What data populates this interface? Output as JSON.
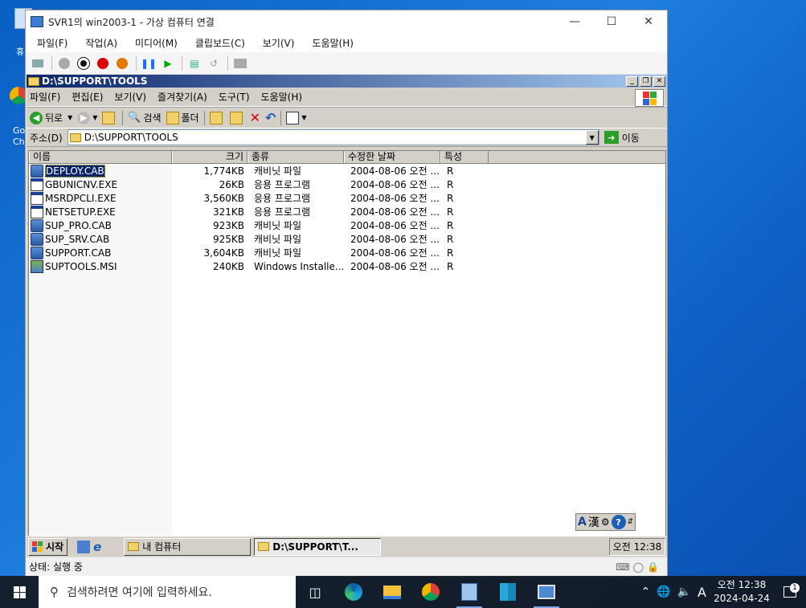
{
  "desktop": {
    "icon_labels": [
      "휴",
      "Go",
      "Ch"
    ]
  },
  "vm_window": {
    "title": "SVR1의 win2003-1 - 가상 컴퓨터 연결",
    "menu": [
      "파일(F)",
      "작업(A)",
      "미디어(M)",
      "클립보드(C)",
      "보기(V)",
      "도움말(H)"
    ],
    "status_label": "상태: 실행 중"
  },
  "explorer": {
    "title": "D:\\SUPPORT\\TOOLS",
    "menu": [
      "파일(F)",
      "편집(E)",
      "보기(V)",
      "즐겨찾기(A)",
      "도구(T)",
      "도움말(H)"
    ],
    "toolbar": {
      "back": "뒤로",
      "search": "검색",
      "folders": "폴더"
    },
    "address": {
      "label": "주소(D)",
      "value": "D:\\SUPPORT\\TOOLS",
      "go": "이동"
    },
    "columns": [
      "이름",
      "크기",
      "종류",
      "수정한 날짜",
      "특성"
    ],
    "files": [
      {
        "name": "DEPLOY.CAB",
        "size": "1,774KB",
        "type": "캐비닛 파일",
        "date": "2004-08-06 오전 ...",
        "attr": "R",
        "icon": "cab-icon"
      },
      {
        "name": "GBUNICNV.EXE",
        "size": "26KB",
        "type": "응용 프로그램",
        "date": "2004-08-06 오전 ...",
        "attr": "R",
        "icon": "exe-icon"
      },
      {
        "name": "MSRDPCLI.EXE",
        "size": "3,560KB",
        "type": "응용 프로그램",
        "date": "2004-08-06 오전 ...",
        "attr": "R",
        "icon": "exe-icon"
      },
      {
        "name": "NETSETUP.EXE",
        "size": "321KB",
        "type": "응용 프로그램",
        "date": "2004-08-06 오전 ...",
        "attr": "R",
        "icon": "exe-icon"
      },
      {
        "name": "SUP_PRO.CAB",
        "size": "923KB",
        "type": "캐비닛 파일",
        "date": "2004-08-06 오전 ...",
        "attr": "R",
        "icon": "cab-icon"
      },
      {
        "name": "SUP_SRV.CAB",
        "size": "925KB",
        "type": "캐비닛 파일",
        "date": "2004-08-06 오전 ...",
        "attr": "R",
        "icon": "cab-icon"
      },
      {
        "name": "SUPPORT.CAB",
        "size": "3,604KB",
        "type": "캐비닛 파일",
        "date": "2004-08-06 오전 ...",
        "attr": "R",
        "icon": "cab-icon"
      },
      {
        "name": "SUPTOOLS.MSI",
        "size": "240KB",
        "type": "Windows Installe...",
        "date": "2004-08-06 오전 ...",
        "attr": "R",
        "icon": "msi-icon"
      }
    ]
  },
  "guest_taskbar": {
    "start": "시작",
    "buttons": [
      "내 컴퓨터",
      "D:\\SUPPORT\\T..."
    ],
    "clock": "오전 12:38",
    "ime": {
      "lang": "A",
      "hanja": "漢"
    }
  },
  "host_taskbar": {
    "search_placeholder": "검색하려면 여기에 입력하세요.",
    "time": "오전 12:38",
    "date": "2024-04-24",
    "ime": "A",
    "notif_count": "1"
  }
}
